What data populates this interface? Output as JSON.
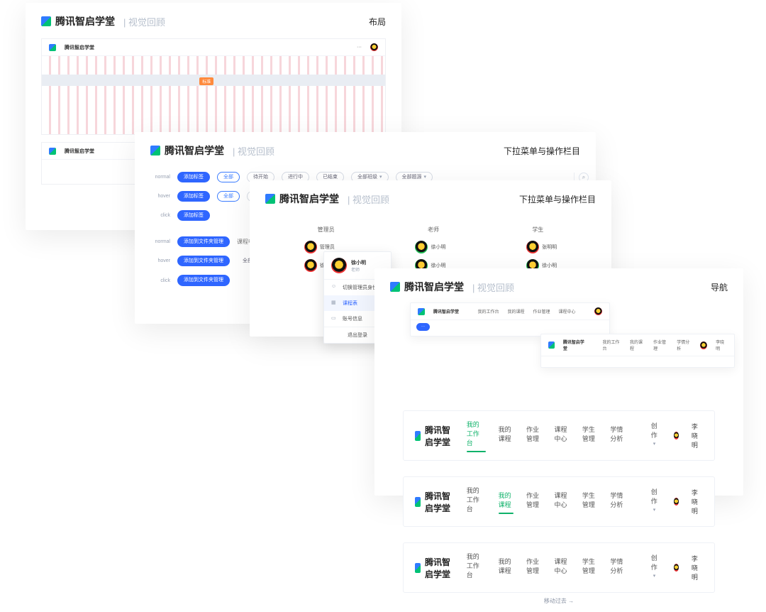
{
  "brand_name": "腾讯智启学堂",
  "subtitle_label": "视觉回顾",
  "card1": {
    "crumb": "布局",
    "chip": "标准"
  },
  "card2": {
    "crumb": "下拉菜单与操作栏目",
    "state_label": {
      "normal": "normal",
      "hover": "hover",
      "click": "click"
    },
    "pill_primary": "添加标签",
    "filters": {
      "all": "全部",
      "not_started": "待开始",
      "running": "进行中",
      "ended": "已结束",
      "all_class": "全部班级",
      "all_source": "全部题源"
    },
    "nav": {
      "center": "课程中心",
      "student": "学生管理",
      "analysis": "学情分析",
      "actions": "创作",
      "user": "徐小明",
      "line3": "添加到文件夹管理"
    },
    "sub_label": "全部筛选"
  },
  "card3": {
    "crumb": "下拉菜单与操作栏目",
    "groups": {
      "admin": "管理员",
      "teacher": "老师",
      "student": "学生"
    },
    "people": {
      "admin": "管理员",
      "p1": "徐小明",
      "p2": "徐小明",
      "p3": "徐小明",
      "p4": "张明明"
    },
    "dropdown": {
      "name": "徐小明",
      "role": "老师",
      "switch": "切换管理员身份",
      "courses": "课程表",
      "account": "账号信息",
      "logout": "退出登录"
    }
  },
  "card4": {
    "crumb": "导航",
    "links": {
      "workbench": "我的工作台",
      "mycourse": "我的课程",
      "homework": "作业管理",
      "course_center": "课程中心",
      "student_mgmt": "学生管理",
      "analysis": "学情分析",
      "actions": "创作",
      "user": "李晓明"
    },
    "move_hint": "移动过去"
  }
}
